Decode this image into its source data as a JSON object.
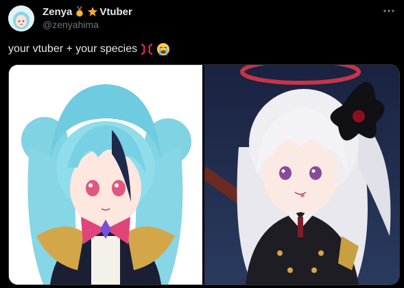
{
  "tweet": {
    "author": {
      "display_name": "Zenya",
      "badge_medal_icon": "medal-icon",
      "badge_star_icon": "star-icon",
      "badge_text": "Vtuber",
      "handle": "@zenyahima",
      "avatar_description": "anime-girl-avatar"
    },
    "more_icon": "more-icon",
    "text": "your vtuber + your species",
    "text_emojis": [
      "anger-symbol-icon",
      "loudly-crying-face-icon"
    ]
  },
  "media": {
    "images": [
      {
        "subject": "blue-haired-vtuber-illustration"
      },
      {
        "subject": "white-haired-character-illustration"
      }
    ]
  },
  "colors": {
    "background": "#000000",
    "text_primary": "#e7e9ea",
    "text_secondary": "#71767b",
    "border": "#2f3336"
  }
}
